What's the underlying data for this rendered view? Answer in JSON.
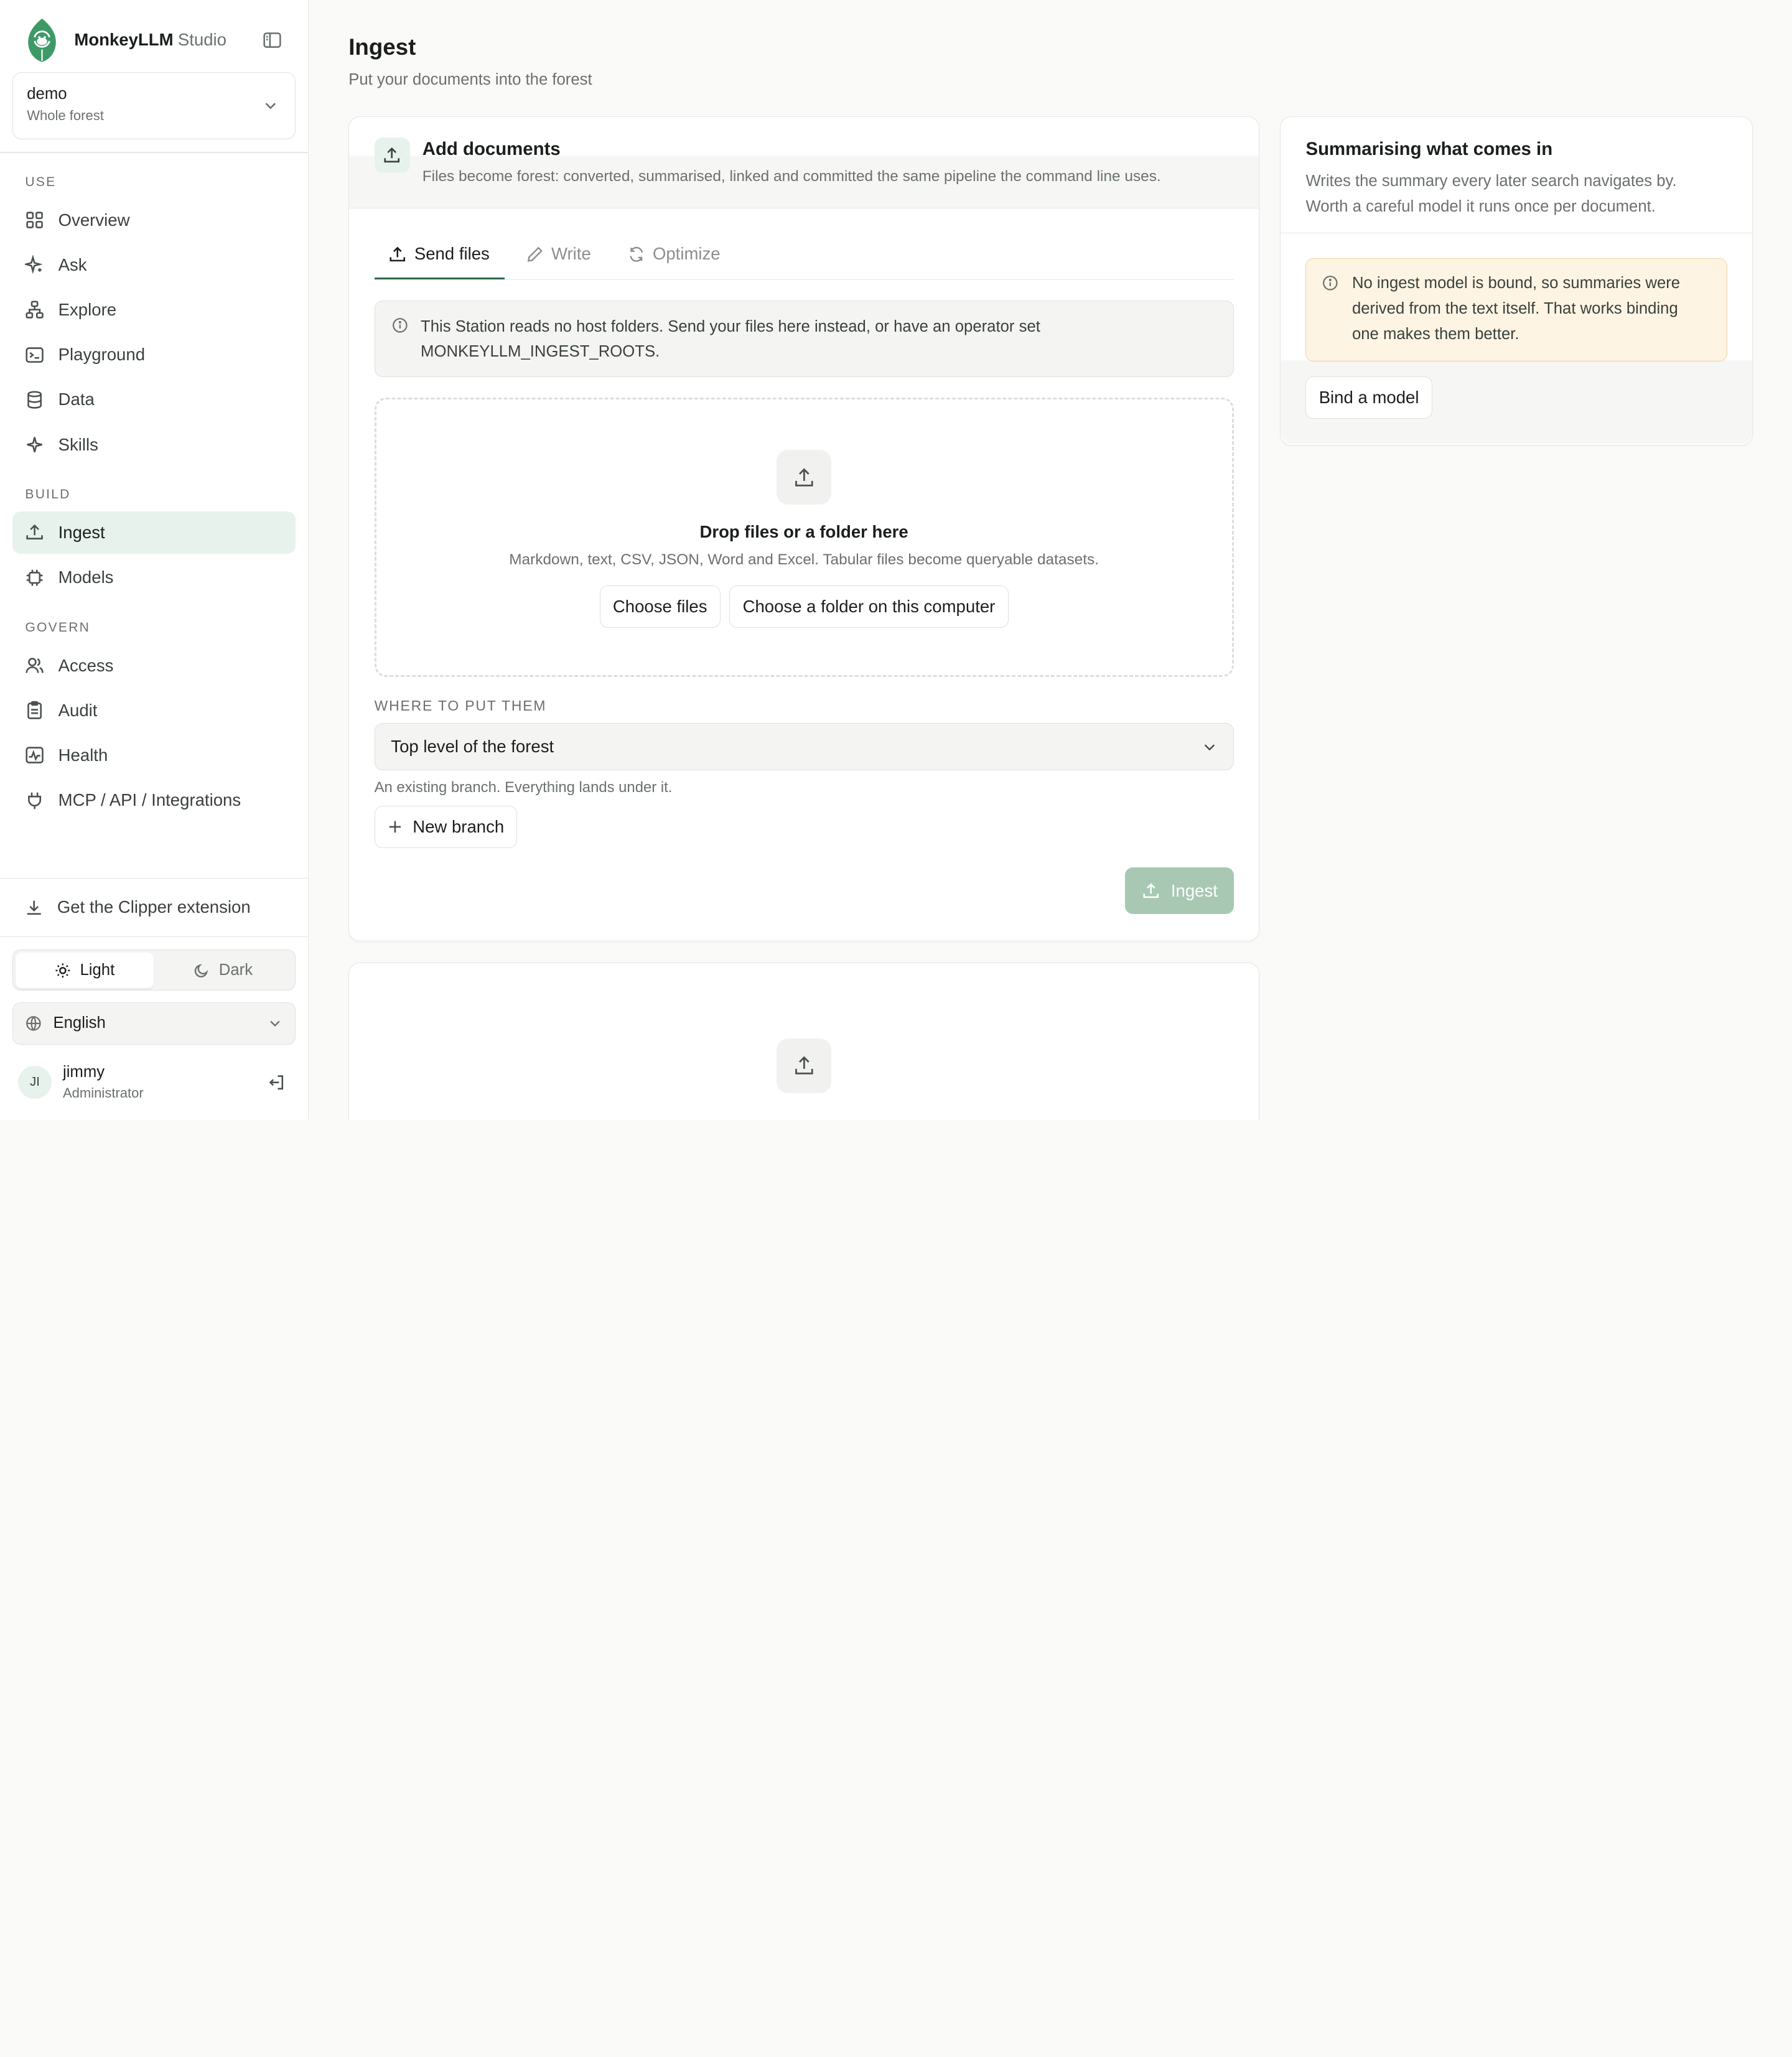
{
  "brand": {
    "name": "MonkeyLLM",
    "suffix": "Studio"
  },
  "workspace": {
    "name": "demo",
    "scope": "Whole forest"
  },
  "nav": {
    "use_label": "USE",
    "use_items": [
      "Overview",
      "Ask",
      "Explore",
      "Playground",
      "Data",
      "Skills"
    ],
    "build_label": "BUILD",
    "build_items": [
      "Ingest",
      "Models"
    ],
    "govern_label": "GOVERN",
    "govern_items": [
      "Access",
      "Audit",
      "Health",
      "MCP / API / Integrations"
    ],
    "active": "Ingest"
  },
  "footer": {
    "clipper": "Get the Clipper extension",
    "theme_light": "Light",
    "theme_dark": "Dark",
    "theme_selected": "Light",
    "language": "English"
  },
  "user": {
    "initials": "JI",
    "name": "jimmy",
    "role": "Administrator"
  },
  "page": {
    "title": "Ingest",
    "subtitle": "Put your documents into the forest"
  },
  "add_card": {
    "title": "Add documents",
    "subtitle": "Files become forest: converted, summarised, linked and committed the same pipeline the command line uses.",
    "tabs": [
      "Send files",
      "Write",
      "Optimize"
    ],
    "active_tab": "Send files",
    "notice_line1": "This Station reads no host folders. Send your files here instead, or have an operator set",
    "notice_line2": "MONKEYLLM_INGEST_ROOTS.",
    "drop_title": "Drop files or a folder here",
    "drop_sub": "Markdown, text, CSV, JSON, Word and Excel. Tabular files become queryable datasets.",
    "choose_files": "Choose files",
    "choose_folder": "Choose a folder on this computer",
    "where_label": "WHERE TO PUT THEM",
    "where_value": "Top level of the forest",
    "where_hint": "An existing branch. Everything lands under it.",
    "new_branch": "New branch",
    "ingest_button": "Ingest"
  },
  "side_card": {
    "title": "Summarising what comes in",
    "subtitle_line1": "Writes the summary every later search navigates by.",
    "subtitle_line2": "Worth a careful model it runs once per document.",
    "warning_line1": "No ingest model is bound, so summaries were",
    "warning_line2": "derived from the text itself. That works binding",
    "warning_line3": "one makes them better.",
    "bind_button": "Bind a model"
  }
}
